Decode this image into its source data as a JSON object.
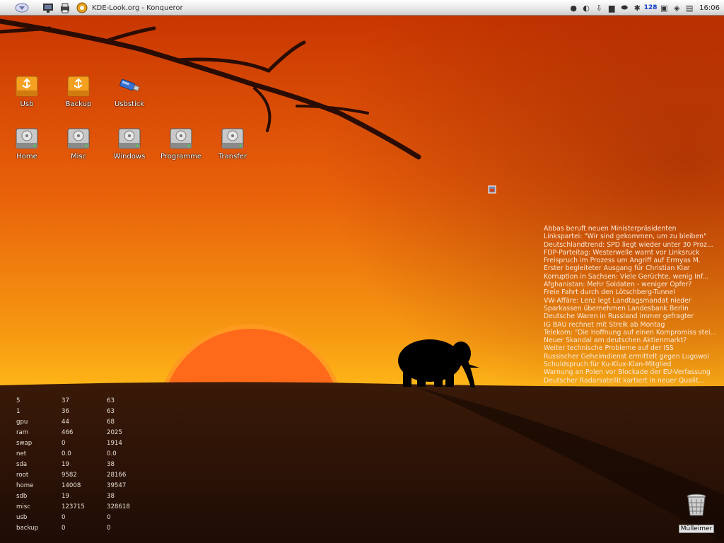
{
  "taskbar": {
    "window_title": "KDE-Look.org - Konqueror",
    "clock": "16:06",
    "battery": "128"
  },
  "desktop_icons": [
    {
      "label": "Usb",
      "icon": "usb-drive-icon"
    },
    {
      "label": "Backup",
      "icon": "usb-drive-icon"
    },
    {
      "label": "Usbstick",
      "icon": "usb-stick-icon"
    },
    {
      "label": "Home",
      "icon": "hard-disk-icon"
    },
    {
      "label": "Misc",
      "icon": "hard-disk-icon"
    },
    {
      "label": "Windows",
      "icon": "hard-disk-icon"
    },
    {
      "label": "Programme",
      "icon": "hard-disk-icon"
    },
    {
      "label": "Transfer",
      "icon": "hard-disk-icon"
    }
  ],
  "news": [
    "Abbas beruft neuen Ministerpräsidenten",
    "Linkspartei: \"Wir sind gekommen, um zu bleiben\"",
    "Deutschlandtrend: SPD liegt wieder unter 30 Proz...",
    "FDP-Parteitag: Westerwelle warnt vor Linksruck",
    "Freispruch im Prozess um Angriff auf Ermyas M.",
    "Erster begleiteter Ausgang für Christian Klar",
    "Korruption in Sachsen: Viele Gerüchte, wenig Inf...",
    "Afghanistan: Mehr Soldaten - weniger Opfer?",
    "Freie Fahrt durch den Lötschberg-Tunnel",
    "VW-Affäre: Lenz legt Landtagsmandat nieder",
    "Sparkassen übernehmen Landesbank Berlin",
    "Deutsche Waren in Russland immer gefragter",
    "IG BAU rechnet mit Streik ab Montag",
    "Telekom: \"Die Hoffnung auf einen Kompromiss stei...",
    "Neuer Skandal am deutschen Aktienmarkt?",
    "Weiter technische Probleme auf der ISS",
    "Russischer Geheimdienst ermittelt gegen Lugowoi",
    "Schuldspruch für Ku-Klux-Klan-Mitglied",
    "Warnung an Polen vor Blockade der EU-Verfassung",
    "Deutscher Radarsatellit kartiert in neuer Qualit..."
  ],
  "sysmon": [
    [
      "5",
      "37",
      "63"
    ],
    [
      "1",
      "36",
      "63"
    ],
    [
      "gpu",
      "44",
      "68"
    ],
    [
      "ram",
      "466",
      "2025"
    ],
    [
      "swap",
      "0",
      "1914"
    ],
    [
      "net",
      "0.0",
      "0.0"
    ],
    [
      "sda",
      "19",
      "38"
    ],
    [
      "root",
      "9582",
      "28166"
    ],
    [
      "home",
      "14008",
      "39547"
    ],
    [
      "sdb",
      "19",
      "38"
    ],
    [
      "misc",
      "123715",
      "328618"
    ],
    [
      "usb",
      "0",
      "0"
    ],
    [
      "backup",
      "0",
      "0"
    ]
  ],
  "trash": {
    "label": "Mülleimer"
  },
  "colors": {
    "sky_top": "#d03a02",
    "sky_mid": "#f07a0a",
    "sun": "#ff6a1a",
    "ground": "#2a1206"
  }
}
